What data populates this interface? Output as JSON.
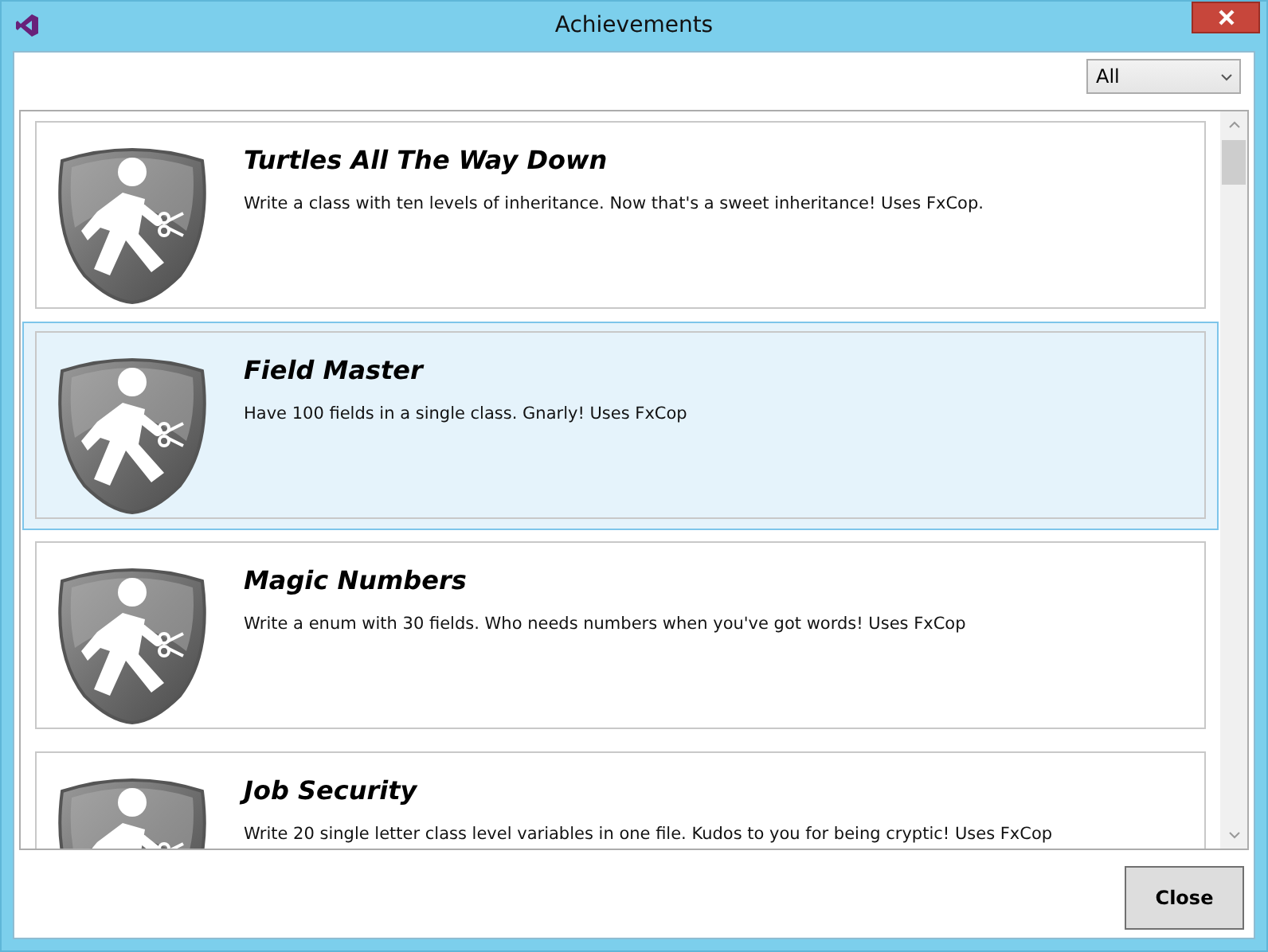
{
  "window": {
    "title": "Achievements"
  },
  "filter": {
    "value": "All"
  },
  "achievements": [
    {
      "title": "Turtles All The Way Down",
      "description": "Write a class with ten levels of inheritance. Now that's a sweet inheritance! Uses FxCop.",
      "selected": false
    },
    {
      "title": "Field Master",
      "description": "Have 100 fields in a single class. Gnarly! Uses FxCop",
      "selected": true
    },
    {
      "title": "Magic Numbers",
      "description": "Write a enum with 30 fields. Who needs numbers when you've got words! Uses FxCop",
      "selected": false
    },
    {
      "title": "Job Security",
      "description": "Write 20 single letter class level variables in one file. Kudos to you for being cryptic! Uses FxCop",
      "selected": false
    }
  ],
  "buttons": [
    {
      "label": "Close"
    }
  ]
}
